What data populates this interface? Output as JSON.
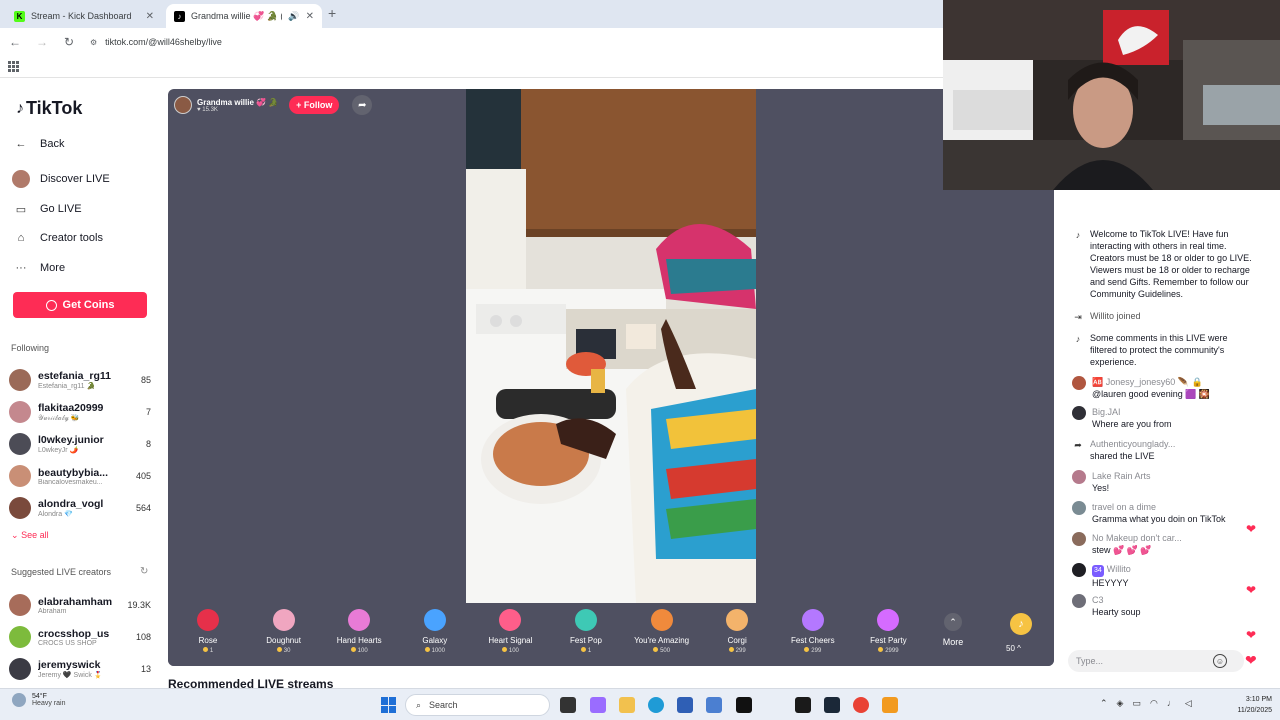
{
  "browser": {
    "tabs": [
      {
        "title": "Stream - Kick Dashboard",
        "favicon": "K"
      },
      {
        "title": "Grandma willie 💞 🐊 (@wi"
      }
    ],
    "url": "tiktok.com/@will46shelby/live"
  },
  "sidebar": {
    "logo": "TikTok",
    "nav": [
      {
        "label": "Back",
        "icon": "arrow-left-icon"
      },
      {
        "label": "Discover LIVE",
        "icon": "live-icon"
      },
      {
        "label": "Go LIVE",
        "icon": "camera-icon"
      },
      {
        "label": "Creator tools",
        "icon": "home-icon"
      },
      {
        "label": "More",
        "icon": "dots-icon"
      }
    ],
    "get_coins": "Get Coins",
    "following_heading": "Following",
    "following": [
      {
        "name": "estefania_rg11",
        "sub": "Estefania_rg11 🐊",
        "count": "85",
        "color": "#9b6a58"
      },
      {
        "name": "flakitaa20999",
        "sub": "𝒴𝓊𝓇𝒾𝒾𝒷𝒶𝒷𝓎 🐝",
        "count": "7",
        "color": "#c4888e"
      },
      {
        "name": "l0wkey.junior",
        "sub": "L0wkeyJr 🌶️",
        "count": "8",
        "color": "#4c4c56"
      },
      {
        "name": "beautybybia...",
        "sub": "Biancalovesmakeu...",
        "count": "405",
        "color": "#c98f76"
      },
      {
        "name": "alondra_vogl",
        "sub": "Alondra 💎",
        "count": "564",
        "color": "#7a4a3c"
      }
    ],
    "see_all": "See all",
    "suggested_heading": "Suggested LIVE creators",
    "suggested": [
      {
        "name": "elabrahamham",
        "sub": "Abraham",
        "count": "19.3K",
        "color": "#a76c5a"
      },
      {
        "name": "crocsshop_us",
        "sub": "CROCS US SHOP",
        "count": "108",
        "color": "#7dbb3c"
      },
      {
        "name": "jeremyswick",
        "sub": "Jeremy 🖤 Swick 🎖️",
        "count": "13",
        "color": "#3b3b44"
      }
    ]
  },
  "live": {
    "host_name": "Grandma willie 💞 🐊",
    "host_viewers": "♥ 15.3K",
    "follow_label": "+ Follow",
    "gifts": [
      {
        "name": "Rose",
        "price": "1",
        "color": "#e6304a"
      },
      {
        "name": "Doughnut",
        "price": "30",
        "color": "#f0a6c0"
      },
      {
        "name": "Hand Hearts",
        "price": "100",
        "color": "#e87bd6"
      },
      {
        "name": "Galaxy",
        "price": "1000",
        "color": "#4aa3ff"
      },
      {
        "name": "Heart Signal",
        "price": "100",
        "color": "#ff5e8a"
      },
      {
        "name": "Fest Pop",
        "price": "1",
        "color": "#3ec9b5"
      },
      {
        "name": "You're Amazing",
        "price": "500",
        "color": "#f08a3c"
      },
      {
        "name": "Corgi",
        "price": "299",
        "color": "#f3b36b"
      },
      {
        "name": "Fest Cheers",
        "price": "299",
        "color": "#b478ff"
      },
      {
        "name": "Fest Party",
        "price": "2999",
        "color": "#d56bff"
      }
    ],
    "more_label": "More",
    "coins_label": "50 ^",
    "recommended": "Recommended LIVE streams"
  },
  "chat": {
    "messages": [
      {
        "type": "system",
        "icon": "tiktok-icon",
        "text": "Welcome to TikTok LIVE! Have fun interacting with others in real time. Creators must be 18 or older to go LIVE. Viewers must be 18 or older to recharge and send Gifts. Remember to follow our Community Guidelines."
      },
      {
        "type": "system",
        "icon": "join-icon",
        "text": "Willito  joined"
      },
      {
        "type": "system",
        "icon": "tiktok-icon",
        "text": "Some comments in this LIVE were filtered to protect the community's experience."
      },
      {
        "type": "user",
        "user": "🆎 Jonesy_jonesy60 🪶 🔒",
        "text": "@lauren good evening 🟪 🎇",
        "color": "#b0563f"
      },
      {
        "type": "user",
        "user": "Big.JAI",
        "text": "Where are you from",
        "color": "#2f2f36"
      },
      {
        "type": "share",
        "icon": "share-icon",
        "user": "Authenticyounglady...",
        "text": "shared the LIVE"
      },
      {
        "type": "user",
        "user": "Lake Rain Arts",
        "text": "Yes!",
        "color": "#b57a8c"
      },
      {
        "type": "user",
        "user": "travel on a dime",
        "text": "Gramma what you doin on TikTok",
        "color": "#7a8b93"
      },
      {
        "type": "user",
        "user": "No Makeup don't car...",
        "text": "stew 💕 💕 💕",
        "color": "#8a6b5c"
      },
      {
        "type": "user",
        "user": "Willito",
        "badge": "34",
        "text": "HEYYYY",
        "color": "#1f1f24"
      },
      {
        "type": "user",
        "user": "C3",
        "text": "Hearty soup",
        "color": "#6e6e78"
      }
    ],
    "input_placeholder": "Type..."
  },
  "taskbar": {
    "weather_temp": "54°F",
    "weather_desc": "Heavy rain",
    "search": "Search",
    "time": "3:10 PM",
    "date": "11/20/2025"
  }
}
